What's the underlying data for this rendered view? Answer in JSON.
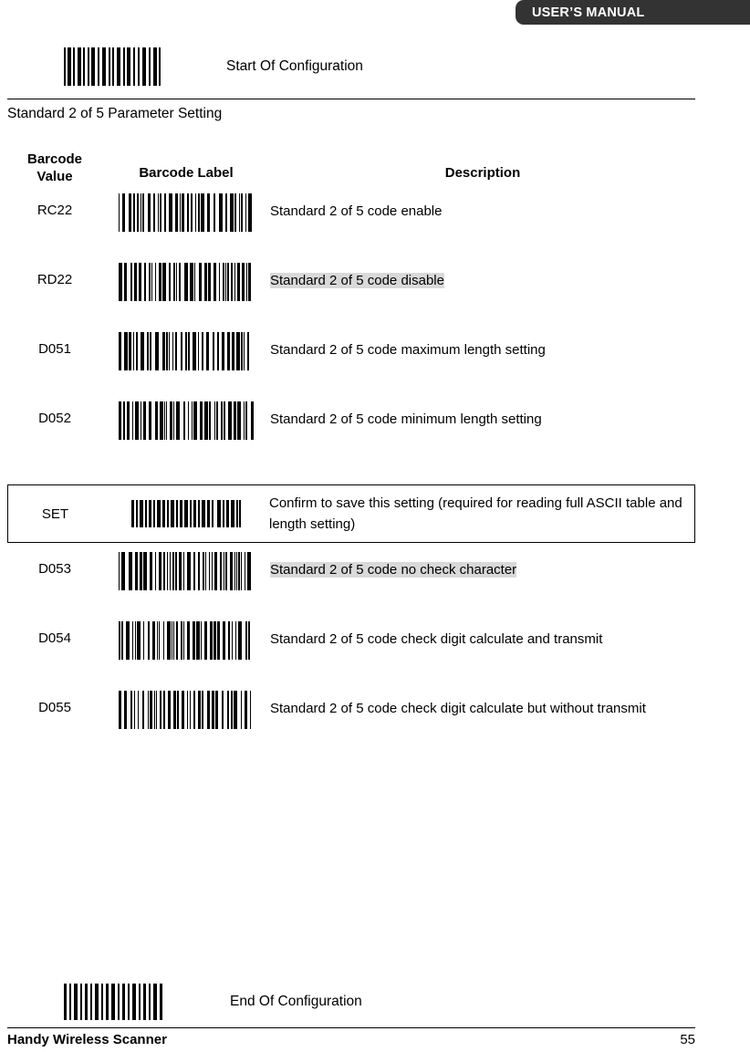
{
  "header": {
    "title": "USER’S MANUAL"
  },
  "start_config": {
    "label": "Start Of Configuration",
    "barcode_icon": "barcode-start-of-configuration"
  },
  "end_config": {
    "label": "End Of Configuration",
    "barcode_icon": "barcode-end-of-configuration"
  },
  "section": {
    "title": "Standard 2 of 5 Parameter Setting"
  },
  "table": {
    "headers": {
      "value": "Barcode\nValue",
      "value_line1": "Barcode",
      "value_line2": "Value",
      "label": "Barcode Label",
      "description": "Description"
    },
    "rows": [
      {
        "value": "RC22",
        "description": "Standard 2 of 5 code enable",
        "highlighted": false,
        "barcode_icon": "barcode-rc22"
      },
      {
        "value": "RD22",
        "description": "Standard 2 of 5 code disable",
        "highlighted": true,
        "barcode_icon": "barcode-rd22"
      },
      {
        "value": "D051",
        "description": "Standard 2 of 5 code maximum length setting",
        "highlighted": false,
        "barcode_icon": "barcode-d051"
      },
      {
        "value": "D052",
        "description": "Standard 2 of 5 code minimum length setting",
        "highlighted": false,
        "barcode_icon": "barcode-d052"
      }
    ],
    "set_row": {
      "value": "SET",
      "description": "Confirm to save this setting (required for reading full ASCII table and length setting)",
      "barcode_icon": "barcode-set"
    },
    "rows_after_set": [
      {
        "value": "D053",
        "description": "Standard 2 of 5 code no check character",
        "highlighted": true,
        "barcode_icon": "barcode-d053"
      },
      {
        "value": "D054",
        "description": "Standard 2 of 5 code check digit calculate and transmit",
        "highlighted": false,
        "barcode_icon": "barcode-d054"
      },
      {
        "value": "D055",
        "description": "Standard 2 of 5 code check digit calculate but without transmit",
        "highlighted": false,
        "barcode_icon": "barcode-d055"
      }
    ]
  },
  "footer": {
    "product": "Handy Wireless Scanner",
    "page_number": "55"
  },
  "colors": {
    "header_bg": "#333333",
    "header_text": "#ffffff",
    "highlight": "#d9d9d9",
    "rule": "#000000",
    "text": "#000000"
  }
}
